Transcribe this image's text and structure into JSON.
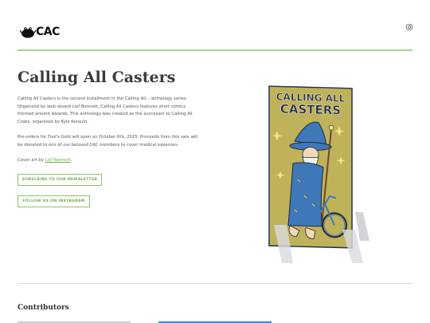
{
  "header": {
    "logo_text": "CAC",
    "social_icon": "instagram-icon"
  },
  "main": {
    "title": "Calling All Casters",
    "paragraph1": "Calling All Casters is the second installment in the Calling All... anthology series. Organized by web wizard Lief Bennett, Calling All Casters features short comics themed around wizards. This anthology was created as the successor to Calling All Crabs, organized by Kyle Kenezzi.",
    "paragraph2": "Pre-orders for Fool's Gold will open on October 6th, 2025. Proceeds from this sale will be donated to one of our beloved CAC members to cover medical expenses.",
    "cover_art_prefix": "Cover art by ",
    "cover_art_link": "Lief Bennett",
    "cover_art_suffix": ".",
    "newsletter_button": "SUBSCRIBE TO OUR NEWSLETTER",
    "instagram_button": "FOLLOW US ON INSTAGRAM"
  },
  "cover": {
    "title_line1": "CALLING ALL",
    "title_line2": "CASTERS",
    "colors": {
      "background": "#e7c23a",
      "accent_blue": "#3f78b8",
      "outline": "#1f2a3a"
    }
  },
  "contributors": {
    "heading": "Contributors"
  },
  "colors": {
    "accent_green": "#6fae4e",
    "rule_green": "#a8cf8f"
  }
}
